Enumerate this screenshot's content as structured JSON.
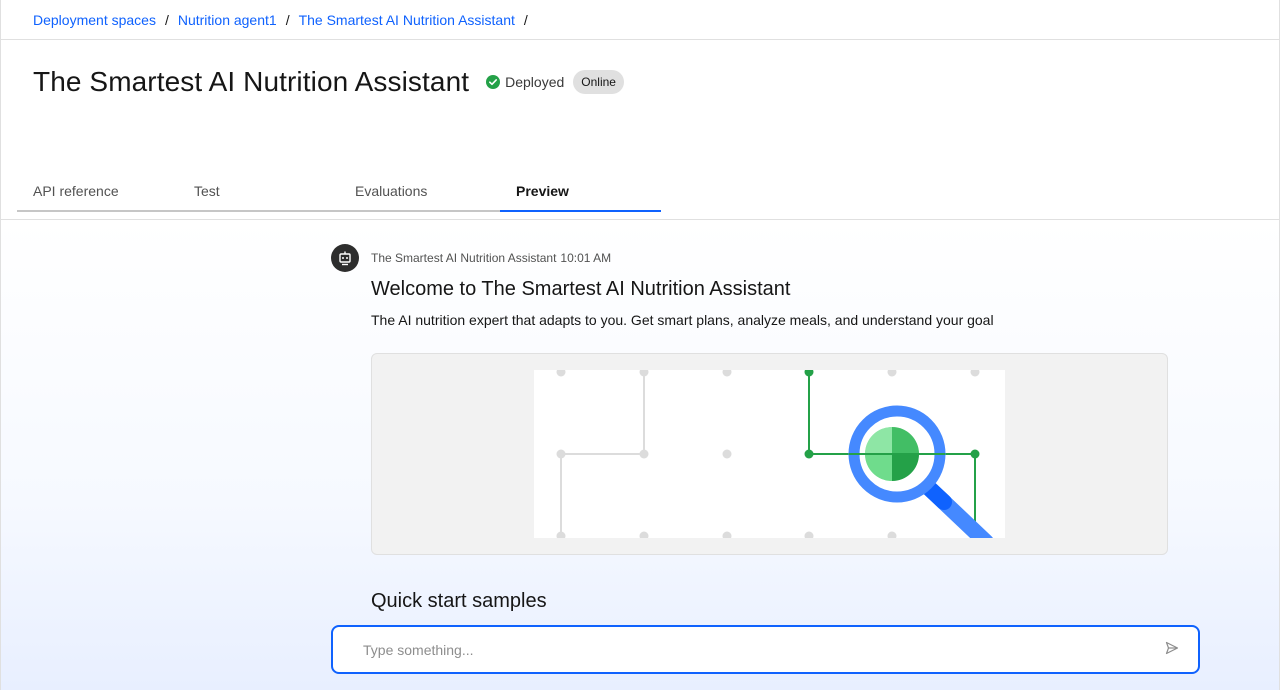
{
  "breadcrumb": {
    "items": [
      {
        "label": "Deployment spaces"
      },
      {
        "label": "Nutrition agent1"
      },
      {
        "label": "The Smartest AI Nutrition Assistant"
      }
    ],
    "separator": "/"
  },
  "header": {
    "title": "The Smartest AI Nutrition Assistant",
    "status_label": "Deployed",
    "status_color": "#24a148",
    "online_tag": "Online"
  },
  "tabs": [
    {
      "label": "API reference",
      "active": false
    },
    {
      "label": "Test",
      "active": false
    },
    {
      "label": "Evaluations",
      "active": false
    },
    {
      "label": "Preview",
      "active": true
    }
  ],
  "chat": {
    "avatar_icon": "robot-icon",
    "sender": "The Smartest AI Nutrition Assistant",
    "time": "10:01 AM",
    "welcome_title": "Welcome to The Smartest AI Nutrition Assistant",
    "welcome_subtitle": "The AI nutrition expert that adapts to you. Get smart plans, analyze meals, and understand your goal",
    "illustration_icon": "magnifier-network-icon",
    "quick_start_title": "Quick start samples",
    "input_placeholder": "Type something...",
    "send_icon": "send-icon"
  },
  "colors": {
    "accent": "#0f62fe",
    "green": "#24a148",
    "magnifier_blue": "#4589ff"
  }
}
